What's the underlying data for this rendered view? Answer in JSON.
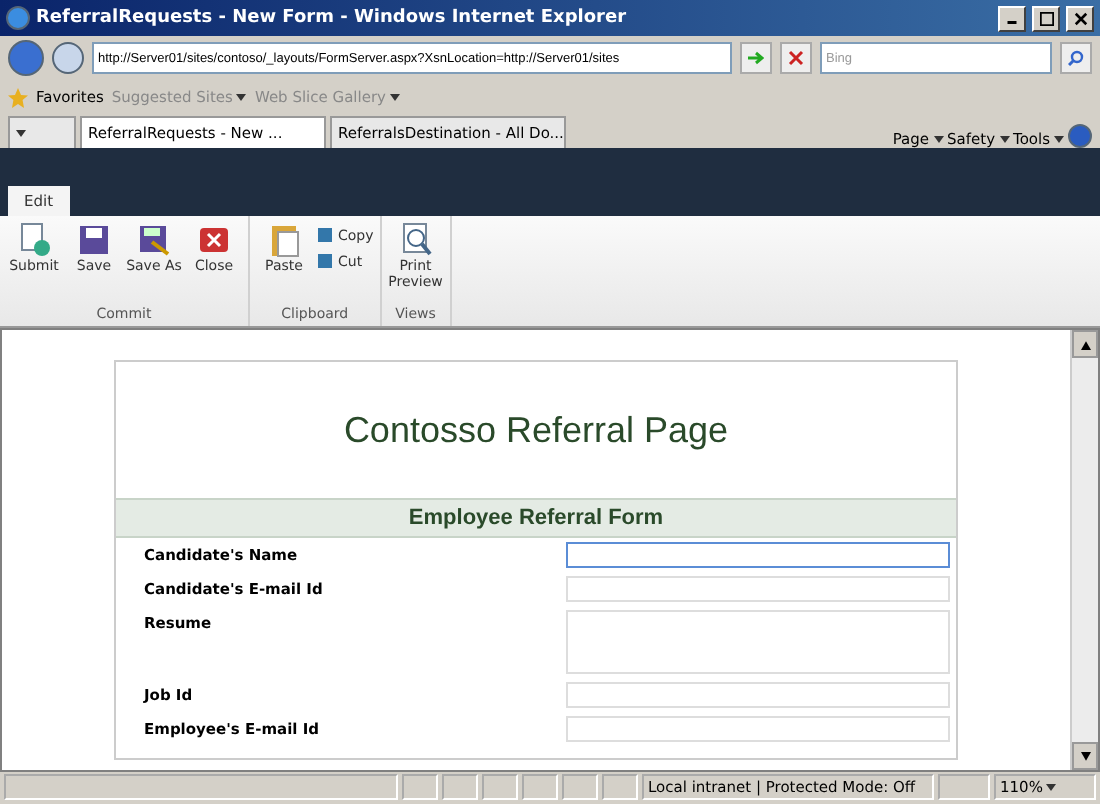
{
  "window": {
    "title": "ReferralRequests - New Form - Windows Internet Explorer"
  },
  "address_bar": {
    "url": "http://Server01/sites/contoso/_layouts/FormServer.aspx?XsnLocation=http://Server01/sites",
    "search_placeholder": "Bing"
  },
  "favorites_bar": {
    "label": "Favorites",
    "links": [
      "Suggested Sites",
      "Web Slice Gallery"
    ]
  },
  "tabs": [
    {
      "label": "ReferralRequests - New ...",
      "selected": true
    },
    {
      "label": "ReferralsDestination - All Do...",
      "selected": false
    }
  ],
  "command_bar": [
    "Page",
    "Safety",
    "Tools"
  ],
  "ribbon": {
    "tabs": [
      {
        "label": "Edit",
        "selected": true
      }
    ],
    "groups": [
      {
        "label": "Commit",
        "buttons": [
          "Submit",
          "Save",
          "Save As",
          "Close"
        ]
      },
      {
        "label": "Clipboard",
        "buttons": [
          "Paste"
        ],
        "small_buttons": [
          "Copy",
          "Cut"
        ]
      },
      {
        "label": "Views",
        "buttons": [
          "Print Preview"
        ]
      }
    ]
  },
  "form": {
    "title": "Contosso Referral Page",
    "section": "Employee Referral Form",
    "fields": [
      {
        "label": "Candidate's Name",
        "kind": "text",
        "focused": true
      },
      {
        "label": "Candidate's E-mail Id",
        "kind": "text",
        "focused": false
      },
      {
        "label": "Resume",
        "kind": "multiline",
        "focused": false
      },
      {
        "label": "Job Id",
        "kind": "text",
        "focused": false
      },
      {
        "label": "Employee's E-mail Id",
        "kind": "text",
        "focused": false
      }
    ]
  },
  "status_bar": {
    "zone": "Local intranet | Protected Mode: Off",
    "zoom": "110%"
  }
}
